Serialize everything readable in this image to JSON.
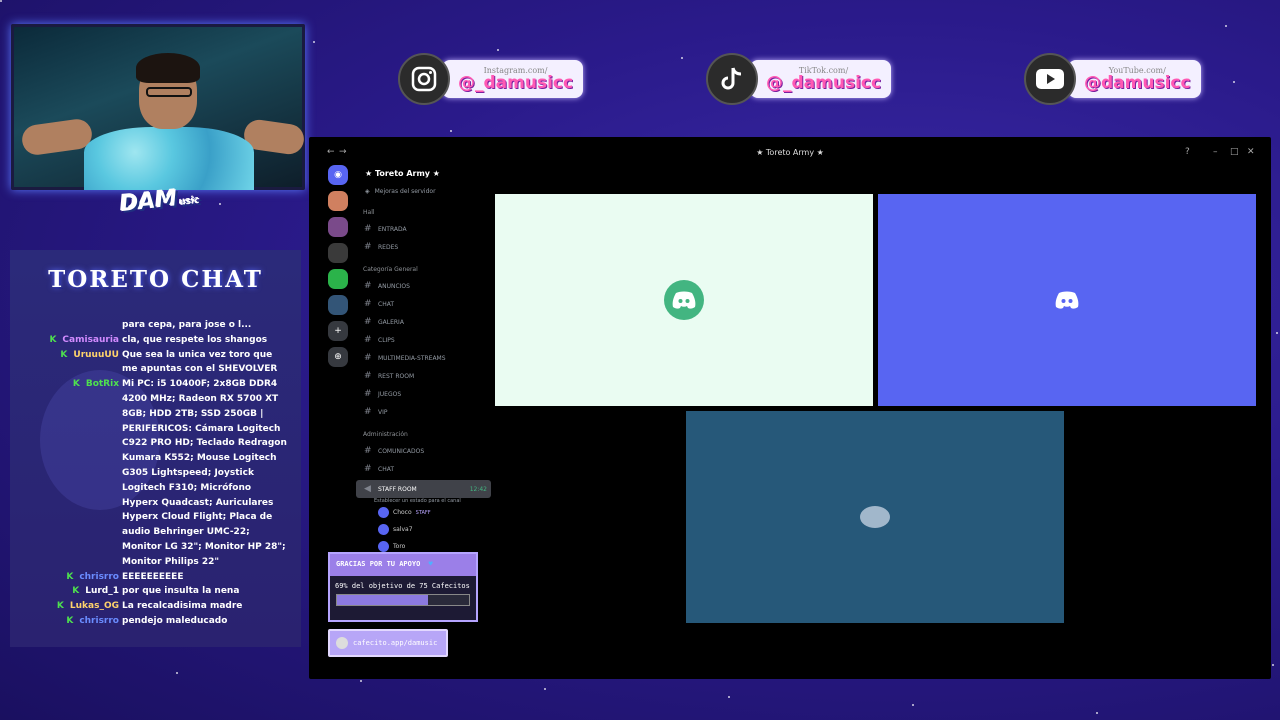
{
  "social": [
    {
      "site": "Instagram.com/",
      "handle": "@_damusicc",
      "icon": "instagram-icon"
    },
    {
      "site": "TikTok.com/",
      "handle": "@_damusicc",
      "icon": "tiktok-icon"
    },
    {
      "site": "YouTube.com/",
      "handle": "@damusicc",
      "icon": "youtube-icon"
    }
  ],
  "logo": {
    "text": "DAM",
    "suffix": "usic"
  },
  "chat": {
    "title": "TORETO CHAT",
    "messages": [
      {
        "user": "",
        "badge": "",
        "msg": "para cepa, para jose o l..."
      },
      {
        "user": "Camisauria",
        "badge": "K",
        "color": "#d28bff",
        "msg": "cla, que respete los shangos"
      },
      {
        "user": "UruuuUU",
        "badge": "K",
        "color": "#ffd36b",
        "msg": "Que sea la unica vez toro que me apuntas con el SHEVOLVER"
      },
      {
        "user": "BotRix",
        "badge": "K",
        "color": "#4ee04e",
        "msg": "Mi PC: i5 10400F; 2x8GB DDR4 4200 MHz; Radeon RX 5700 XT 8GB; HDD 2TB; SSD 250GB | PERIFERICOS: Cámara Logitech C922 PRO HD; Teclado Redragon Kumara K552; Mouse Logitech G305 Lightspeed; Joystick Logitech F310; Micrófono Hyperx Quadcast; Auriculares Hyperx Cloud Flight; Placa de audio Behringer UMC-22; Monitor LG 32\"; Monitor HP 28\"; Monitor Philips 22\""
      },
      {
        "user": "chrisrro",
        "badge": "K",
        "color": "#6a8cff",
        "msg": "EEEEEEEEEE"
      },
      {
        "user": "Lurd_1",
        "badge": "K",
        "color": "#ffffff",
        "msg": "por que insulta la nena"
      },
      {
        "user": "Lukas_OG",
        "badge": "K",
        "color": "#ffd36b",
        "msg": "La recalcadisima madre"
      },
      {
        "user": "chrisrro",
        "badge": "K",
        "color": "#6a8cff",
        "msg": "pendejo maleducado"
      }
    ]
  },
  "discord": {
    "window_title": "★ Toreto Army ★",
    "server_name": "★ Toreto Army ★",
    "boost": "Mejoras del servidor",
    "categories": [
      {
        "name": "Hall",
        "channels": [
          "ENTRADA",
          "REDES"
        ]
      },
      {
        "name": "Categoría General",
        "channels": [
          "ANUNCIOS",
          "CHAT",
          "GALERIA",
          "CLIPS",
          "MULTIMEDIA-STREAMS",
          "REST ROOM",
          "JUEGOS",
          "VIP"
        ]
      },
      {
        "name": "Administración",
        "channels": [
          "COMUNICADOS",
          "CHAT"
        ]
      }
    ],
    "voice_channel": {
      "name": "STAFF ROOM",
      "time": "12:42",
      "status": "Establecer un estado para el canal"
    },
    "voice_users": [
      {
        "name": "Choco",
        "tag": "STAFF"
      },
      {
        "name": "salva7",
        "tag": ""
      },
      {
        "name": "Toro",
        "tag": ""
      }
    ]
  },
  "donation": {
    "title": "GRACIAS POR TU APOYO",
    "goal": "69% del objetivo de 75 Cafecitos",
    "progress": 0.69,
    "link": "cafecito.app/damusic"
  }
}
